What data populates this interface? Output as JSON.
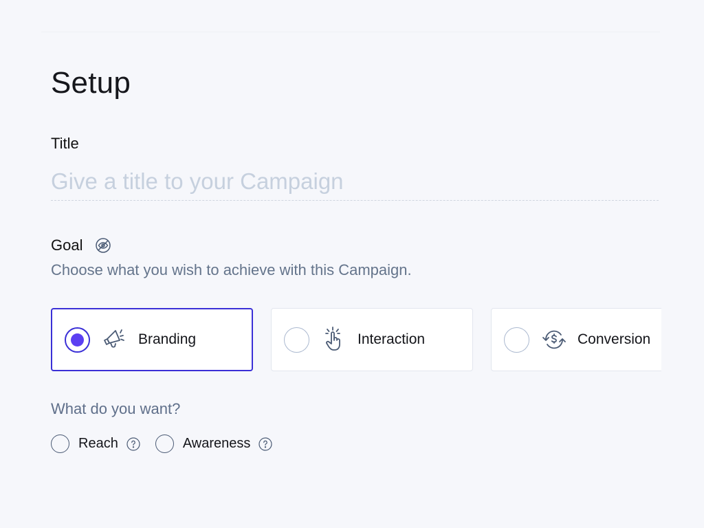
{
  "page": {
    "title": "Setup"
  },
  "title_field": {
    "label": "Title",
    "value": "",
    "placeholder": "Give a title to your Campaign"
  },
  "goal": {
    "label": "Goal",
    "icon": "eye-slash-icon",
    "description": "Choose what you wish to achieve with this Campaign.",
    "options": [
      {
        "label": "Branding",
        "icon": "megaphone-icon",
        "selected": true
      },
      {
        "label": "Interaction",
        "icon": "tap-hand-icon",
        "selected": false
      },
      {
        "label": "Conversion",
        "icon": "dollar-cycle-icon",
        "selected": false
      }
    ]
  },
  "want": {
    "label": "What do you want?",
    "options": [
      {
        "label": "Reach",
        "selected": false,
        "help_icon": "question-circle-icon"
      },
      {
        "label": "Awareness",
        "selected": false,
        "help_icon": "question-circle-icon"
      }
    ]
  },
  "colors": {
    "accent": "#3a2fd6",
    "selected_dot": "#5b3ff2",
    "placeholder": "#c6d0de",
    "muted_text": "#64748b",
    "icon": "#4a5a74"
  }
}
